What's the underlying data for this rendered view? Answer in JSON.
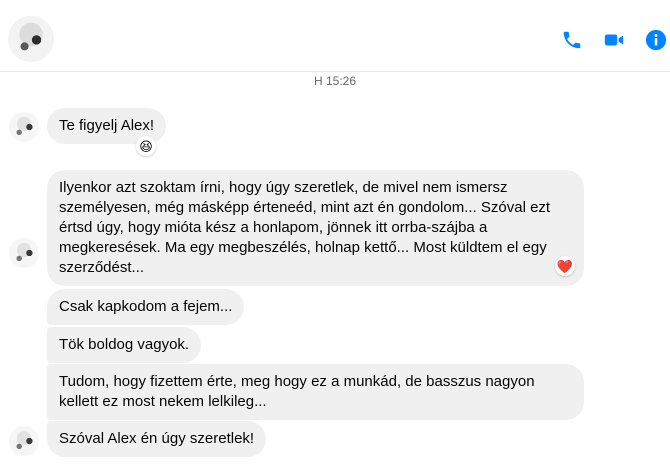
{
  "header": {
    "call_icon": "phone-icon",
    "video_icon": "video-camera-icon",
    "info_icon": "info-icon",
    "accent_color": "#0084ff"
  },
  "timestamp": "H 15:26",
  "messages": [
    {
      "text": "Te figyelj Alex!",
      "reaction": "😆"
    },
    {
      "text": "Ilyenkor azt szoktam írni, hogy úgy szeretlek, de mivel nem ismersz személyesen, még másképp érteneéd, mint azt én gondolom... Szóval ezt értsd úgy, hogy mióta kész a honlapom, jönnek itt orrba-szájba a megkeresések. Ma egy megbeszélés, holnap kettő... Most küldtem el egy szerződést...",
      "reaction": "❤️"
    },
    {
      "text": "Csak kapkodom a fejem..."
    },
    {
      "text": "Tök boldog vagyok."
    },
    {
      "text": "Tudom, hogy fizettem érte, meg hogy ez a munkád, de basszus nagyon kellett ez most nekem lelkileg..."
    },
    {
      "text": "Szóval Alex én úgy szeretlek!"
    }
  ]
}
